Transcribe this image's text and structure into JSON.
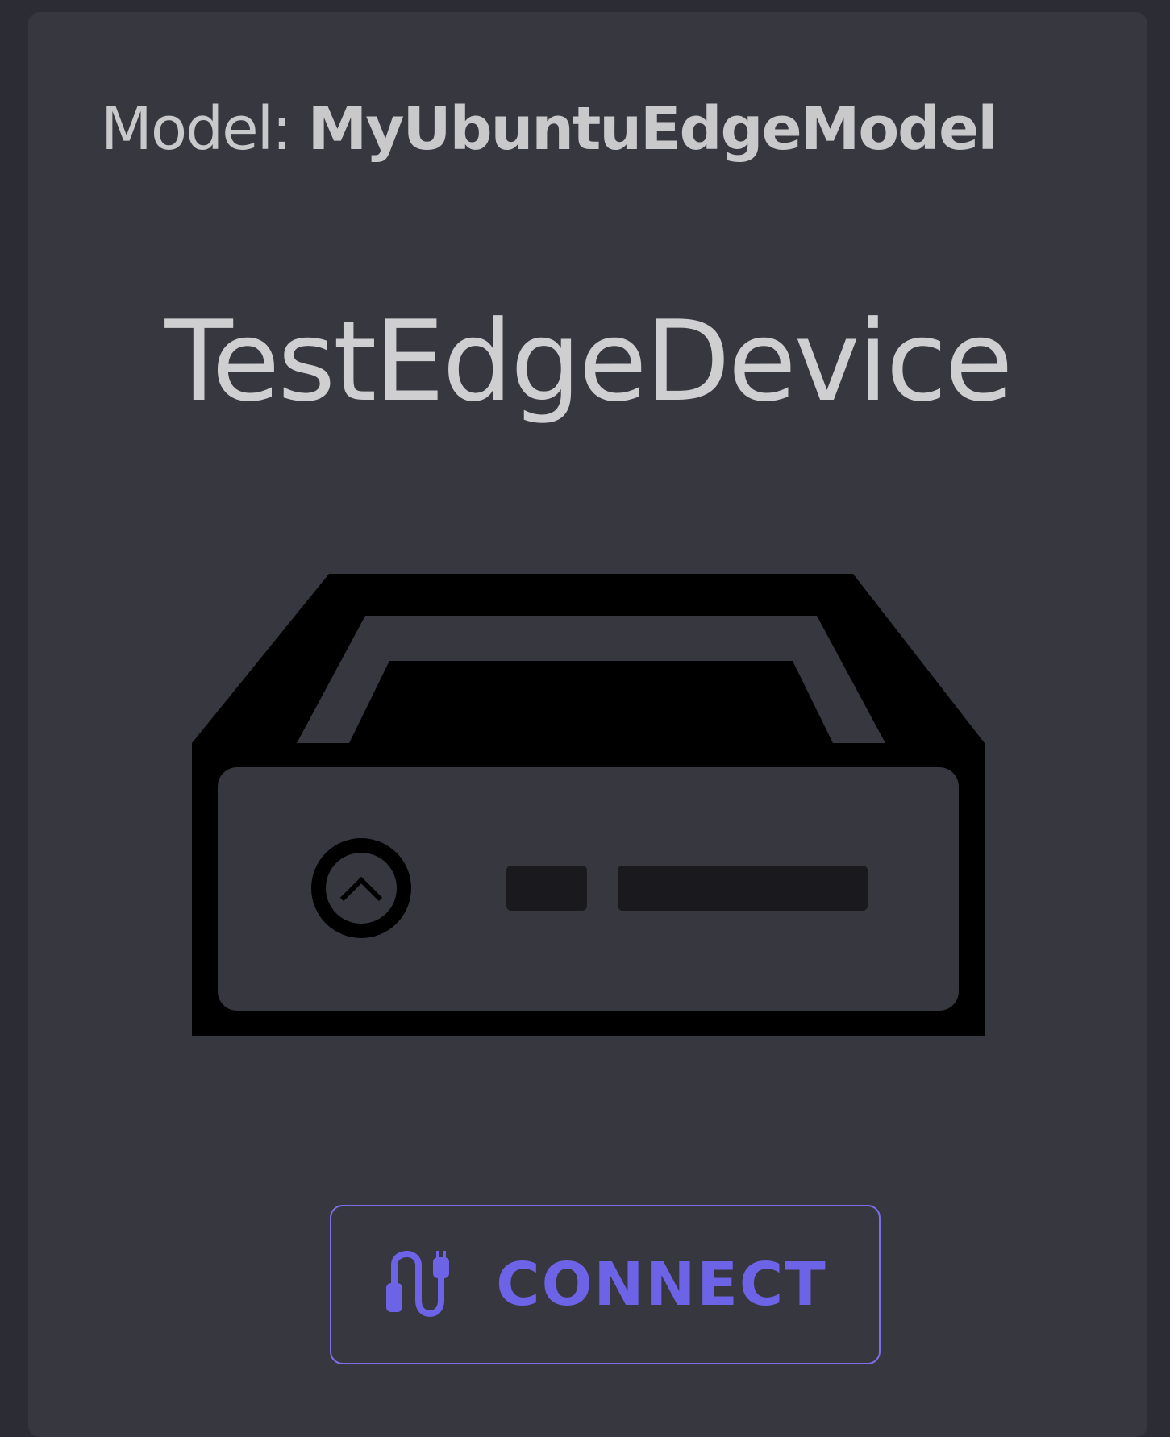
{
  "card": {
    "model_label": "Model:",
    "model_value": "MyUbuntuEdgeModel",
    "device_name": "TestEdgeDevice",
    "device_icon": "edge-device-icon",
    "connect_button": {
      "label": "CONNECT",
      "icon": "connect-cable-icon"
    }
  },
  "colors": {
    "page_background": "#2c2c35",
    "card_background": "#373740",
    "text": "#cfcfd1",
    "accent": "#6d63e6",
    "icon": "#000000"
  }
}
